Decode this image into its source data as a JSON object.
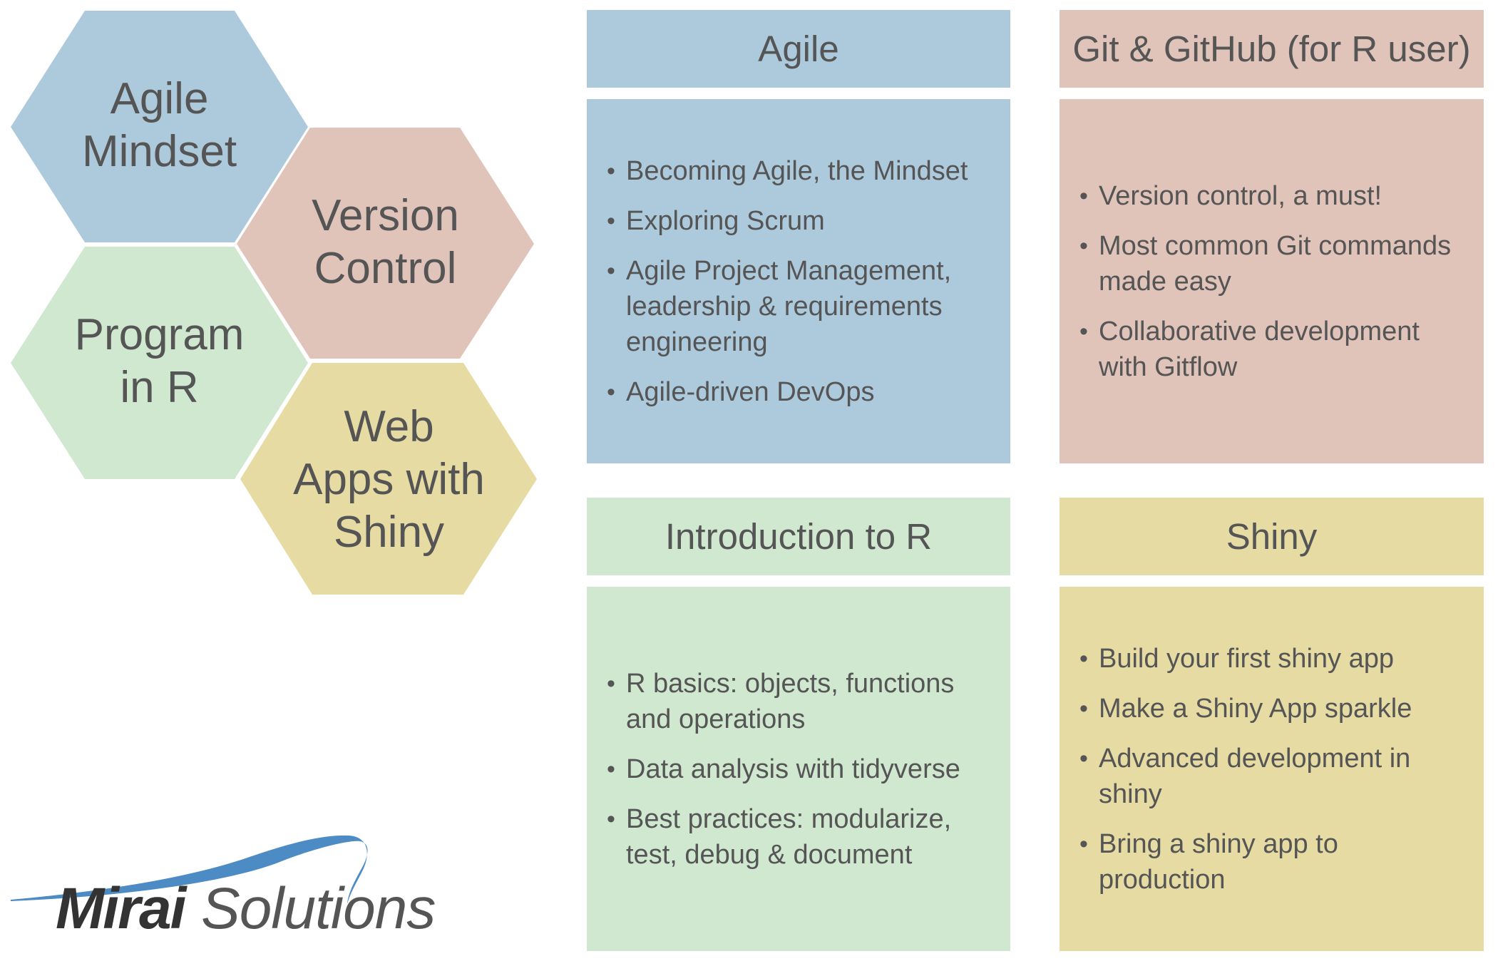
{
  "hexagons": [
    {
      "id": "agile-mindset",
      "lines": [
        "Agile",
        "Mindset"
      ],
      "color": "#adc9dc"
    },
    {
      "id": "version-control",
      "lines": [
        "Version",
        "Control"
      ],
      "color": "#e0c3b9"
    },
    {
      "id": "program-in-r",
      "lines": [
        "Program",
        "in R"
      ],
      "color": "#d0e8d0"
    },
    {
      "id": "web-apps-shiny",
      "lines": [
        "Web",
        "Apps with",
        "Shiny"
      ],
      "color": "#e6dba3"
    }
  ],
  "courses": {
    "agile": {
      "title": "Agile",
      "color": "#adc9dc",
      "items": [
        "Becoming Agile, the Mindset",
        "Exploring Scrum",
        "Agile Project Management, leadership & requirements engineering",
        "Agile-driven DevOps"
      ]
    },
    "git": {
      "title": "Git & GitHub (for R user)",
      "color": "#e0c3b9",
      "items": [
        "Version control, a must!",
        "Most common Git commands made easy",
        "Collaborative development with Gitflow"
      ]
    },
    "intro_r": {
      "title": "Introduction to R",
      "color": "#d0e8d0",
      "items": [
        "R basics: objects, functions and operations",
        "Data analysis with tidyverse",
        "Best practices: modularize, test, debug & document"
      ]
    },
    "shiny": {
      "title": "Shiny",
      "color": "#e6dba3",
      "items": [
        "Build your first shiny app",
        "Make a Shiny App sparkle",
        "Advanced development in shiny",
        "Bring a shiny app to production"
      ]
    }
  },
  "logo": {
    "word1": "Mirai",
    "word2": "Solutions",
    "swoosh_color": "#4d8bc4"
  },
  "bullet_glyph": "•"
}
